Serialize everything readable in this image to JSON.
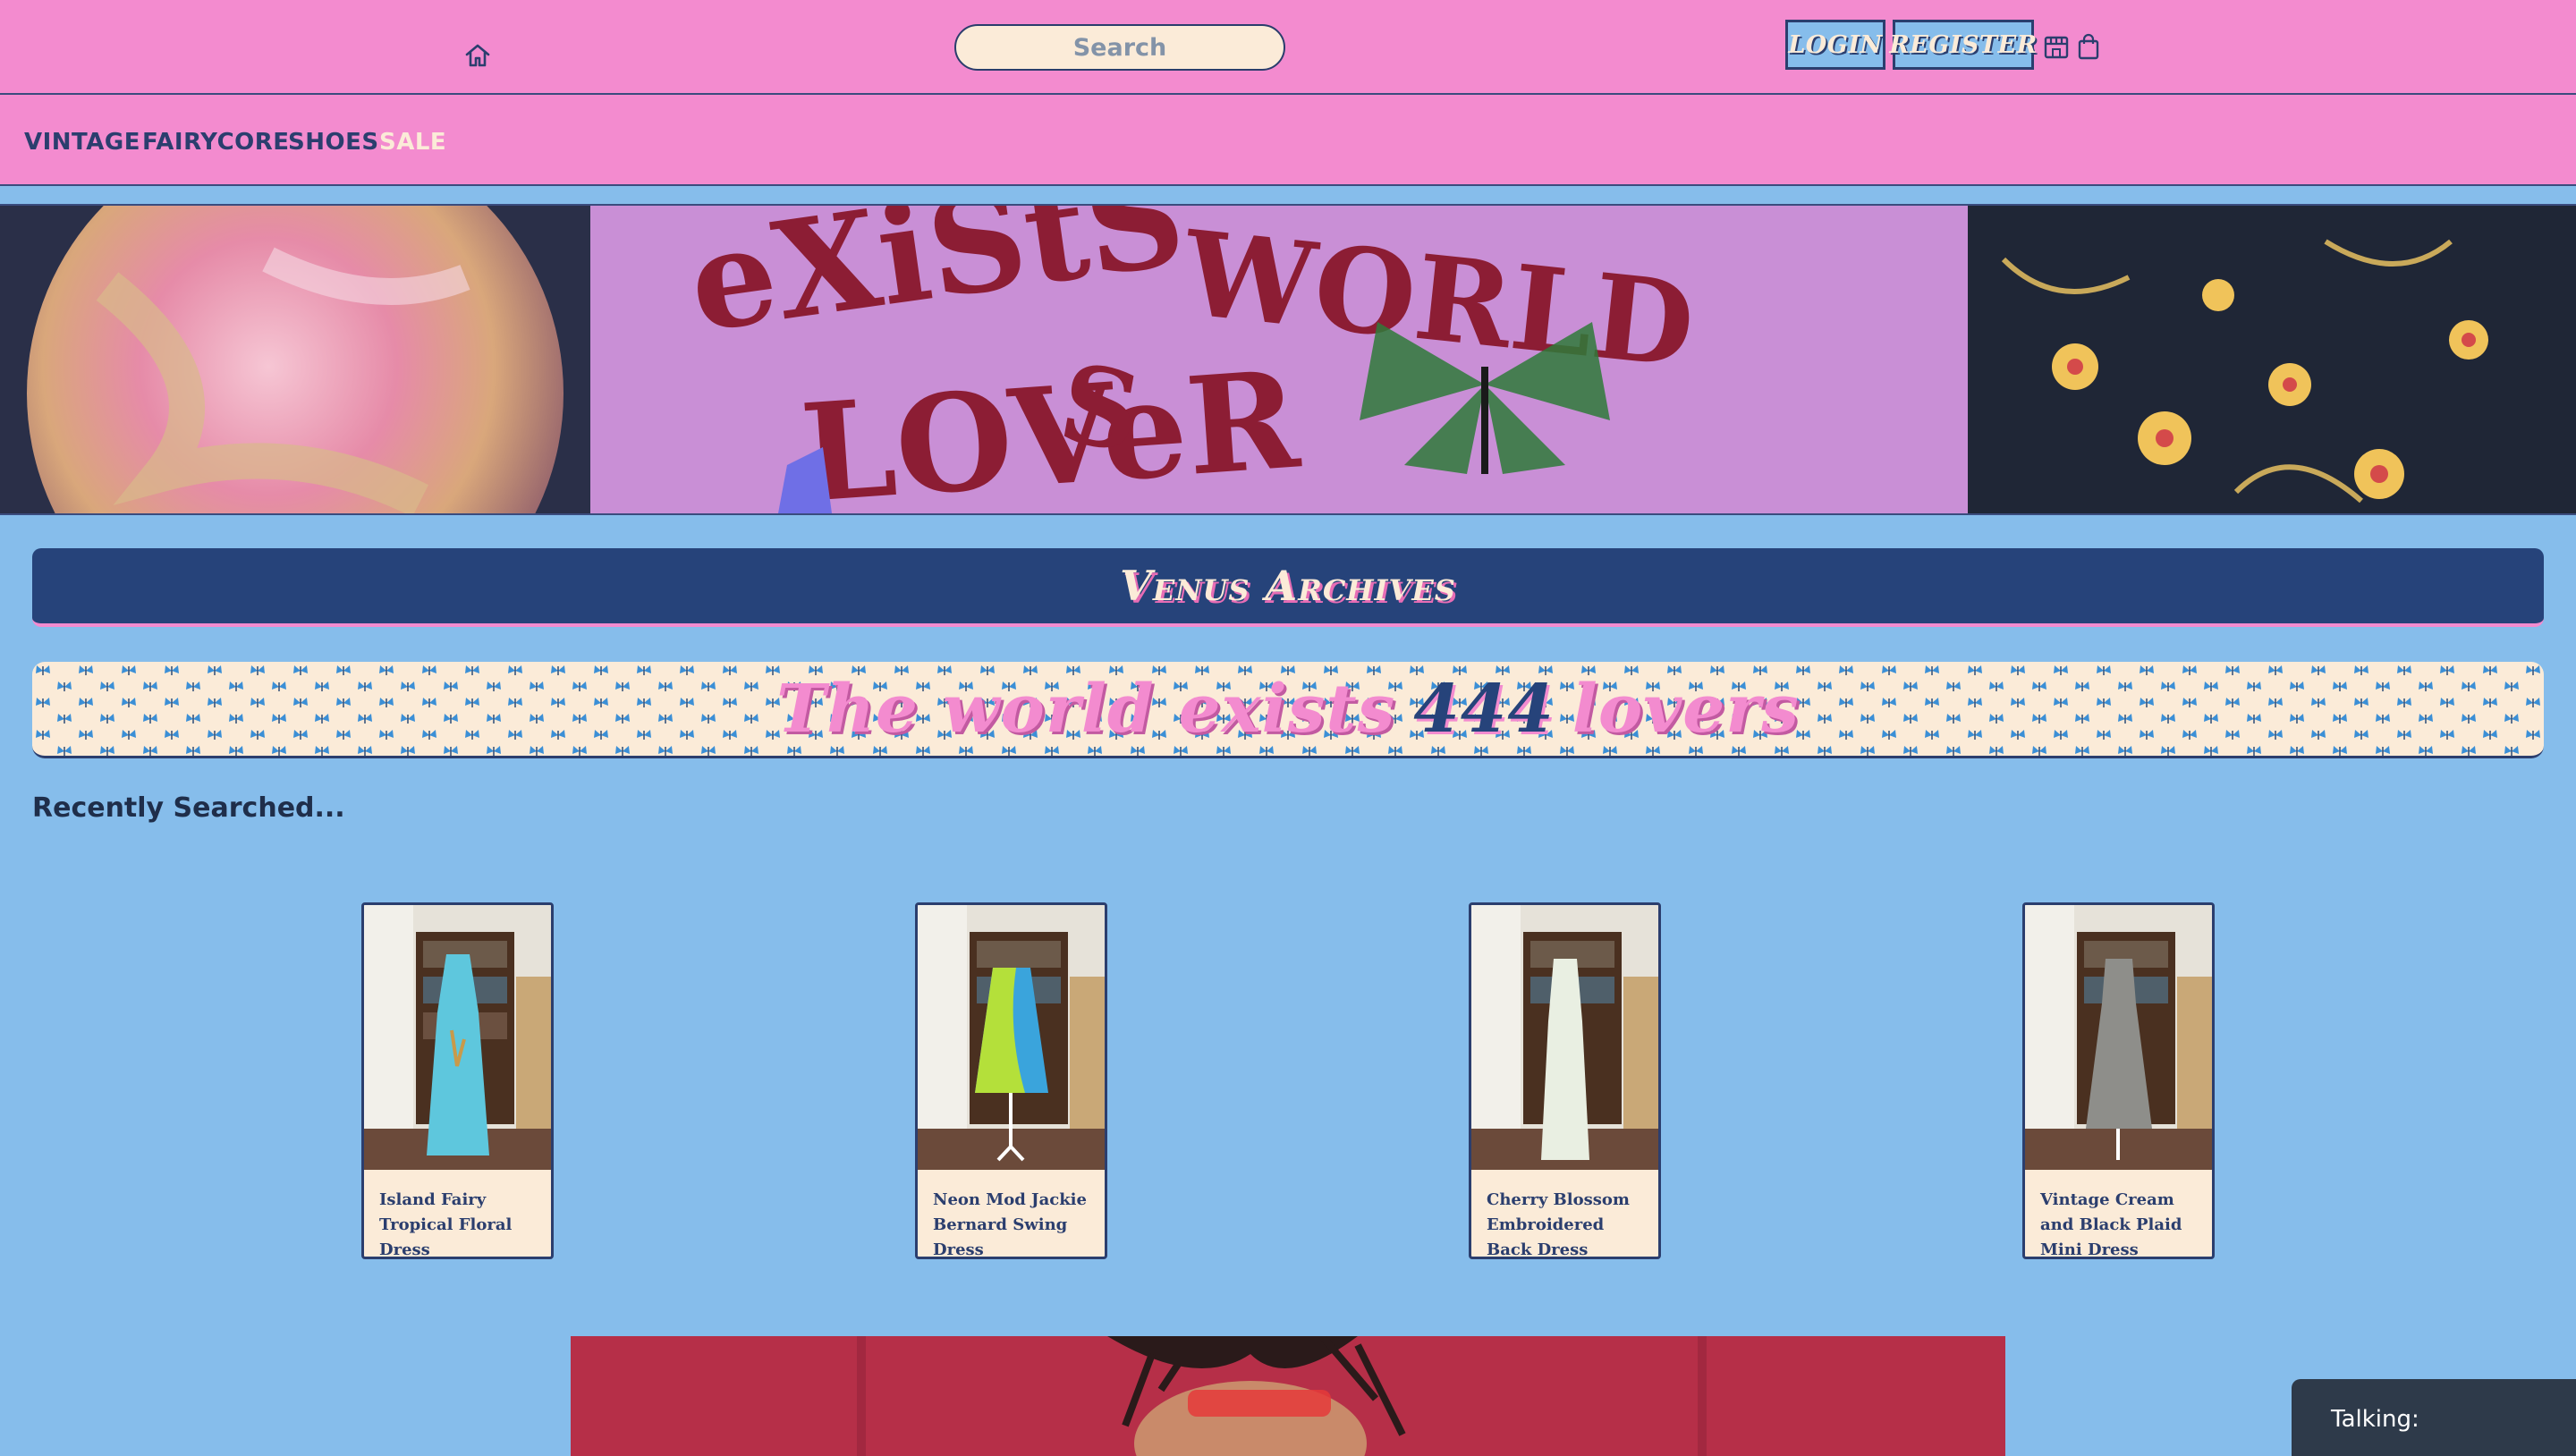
{
  "header": {
    "search_placeholder": "Search",
    "login_label": "LOGIN",
    "register_label": "REGISTER",
    "icons": [
      "home-icon",
      "store-icon",
      "shopping-bag-icon"
    ]
  },
  "nav": {
    "items": [
      {
        "label": "VINTAGE"
      },
      {
        "label": "FAIRYCORE"
      },
      {
        "label": "SHOES"
      },
      {
        "label": "SALE"
      }
    ]
  },
  "main": {
    "title": "Venus Archives",
    "marquee": {
      "part1": "The world exists",
      "number": "444",
      "part2": "lovers"
    },
    "recent_heading": "Recently Searched...",
    "products": [
      {
        "title": "Island Fairy Tropical Floral Dress"
      },
      {
        "title": "Neon Mod Jackie Bernard Swing Dress"
      },
      {
        "title": "Cherry Blossom Embroidered Back Dress"
      },
      {
        "title": "Vintage Cream and Black Plaid Mini Dress"
      }
    ]
  },
  "chat": {
    "label": "Talking:"
  },
  "colors": {
    "header_pink": "#f38bcf",
    "page_blue": "#86bdeb",
    "navy": "#26437a",
    "cream": "#fbebd8"
  }
}
